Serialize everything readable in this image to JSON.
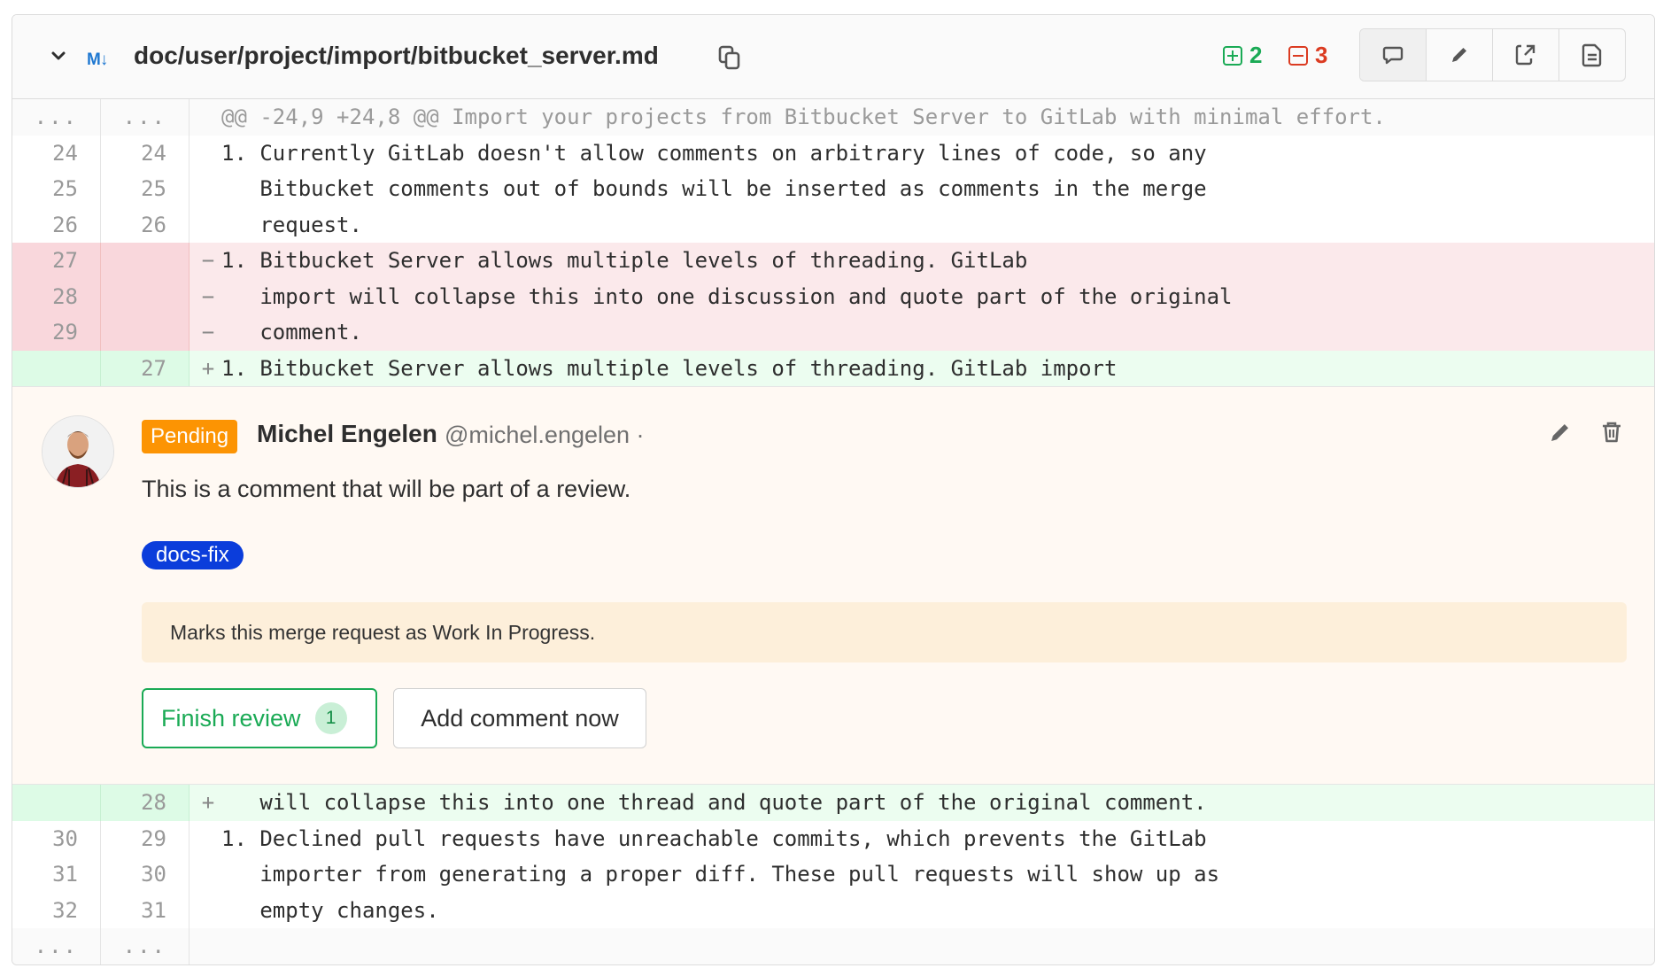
{
  "file": {
    "path": "doc/user/project/import/bitbucket_server.md",
    "added": "2",
    "removed": "3",
    "colors": {
      "added": "#1aaa55",
      "removed": "#db3b21",
      "markdown_icon": "#1f78d1"
    },
    "markdown_icon_label": "M↓",
    "toolbar_icons": [
      "comment-icon",
      "pencil-icon",
      "external-link-icon",
      "file-icon"
    ]
  },
  "diff_before": [
    {
      "type": "match",
      "old": "...",
      "new": "...",
      "sign": "",
      "text": "@@ -24,9 +24,8 @@ Import your projects from Bitbucket Server to GitLab with minimal effort."
    },
    {
      "type": "context",
      "old": "24",
      "new": "24",
      "sign": "",
      "text": "1. Currently GitLab doesn't allow comments on arbitrary lines of code, so any"
    },
    {
      "type": "context",
      "old": "25",
      "new": "25",
      "sign": "",
      "text": "   Bitbucket comments out of bounds will be inserted as comments in the merge"
    },
    {
      "type": "context",
      "old": "26",
      "new": "26",
      "sign": "",
      "text": "   request."
    },
    {
      "type": "old",
      "old": "27",
      "new": "",
      "sign": "−",
      "text": "1. Bitbucket Server allows multiple levels of threading. GitLab"
    },
    {
      "type": "old",
      "old": "28",
      "new": "",
      "sign": "−",
      "text": "   import will collapse this into one discussion and quote part of the original"
    },
    {
      "type": "old",
      "old": "29",
      "new": "",
      "sign": "−",
      "text": "   comment."
    },
    {
      "type": "new",
      "old": "",
      "new": "27",
      "sign": "+",
      "text": "1. Bitbucket Server allows multiple levels of threading. GitLab import"
    }
  ],
  "comment": {
    "badge": "Pending",
    "author": "Michel Engelen",
    "handle": "@michel.engelen ·",
    "body": "This is a comment that will be part of a review.",
    "label": "docs-fix",
    "wip_notice": "Marks this merge request as Work In Progress.",
    "finish_review": "Finish review",
    "finish_count": "1",
    "add_comment_now": "Add comment now",
    "colors": {
      "pending": "#fc9403",
      "label": "#0b3ddb"
    }
  },
  "diff_after": [
    {
      "type": "new",
      "old": "",
      "new": "28",
      "sign": "+",
      "text": "   will collapse this into one thread and quote part of the original comment."
    },
    {
      "type": "context",
      "old": "30",
      "new": "29",
      "sign": "",
      "text": "1. Declined pull requests have unreachable commits, which prevents the GitLab"
    },
    {
      "type": "context",
      "old": "31",
      "new": "30",
      "sign": "",
      "text": "   importer from generating a proper diff. These pull requests will show up as"
    },
    {
      "type": "context",
      "old": "32",
      "new": "31",
      "sign": "",
      "text": "   empty changes."
    },
    {
      "type": "match",
      "old": "...",
      "new": "...",
      "sign": "",
      "text": ""
    }
  ]
}
